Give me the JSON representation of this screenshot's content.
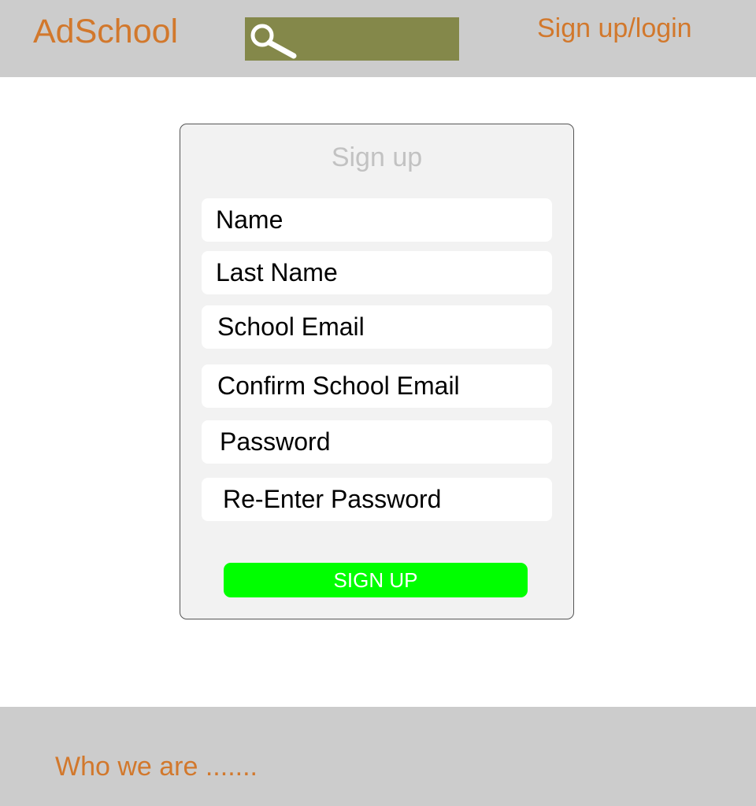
{
  "header": {
    "logo_text": "AdSchool",
    "search": {
      "icon": "magnifier-icon",
      "placeholder": "",
      "value": ""
    },
    "auth_link": "Sign up/login"
  },
  "signup_form": {
    "title": "Sign up",
    "fields": [
      {
        "placeholder": "Name"
      },
      {
        "placeholder": "Last Name"
      },
      {
        "placeholder": "School Email"
      },
      {
        "placeholder": "Confirm School Email"
      },
      {
        "placeholder": "Password"
      },
      {
        "placeholder": "Re-Enter Password"
      }
    ],
    "submit_label": "SIGN UP"
  },
  "footer": {
    "text": "Who we are ......."
  },
  "colors": {
    "header_bg": "#cccccc",
    "accent_orange": "#d2782c",
    "search_bg": "#84884a",
    "card_bg": "#f2f2f2",
    "button_green": "#00ff00",
    "title_gray": "#c2c2c2"
  }
}
